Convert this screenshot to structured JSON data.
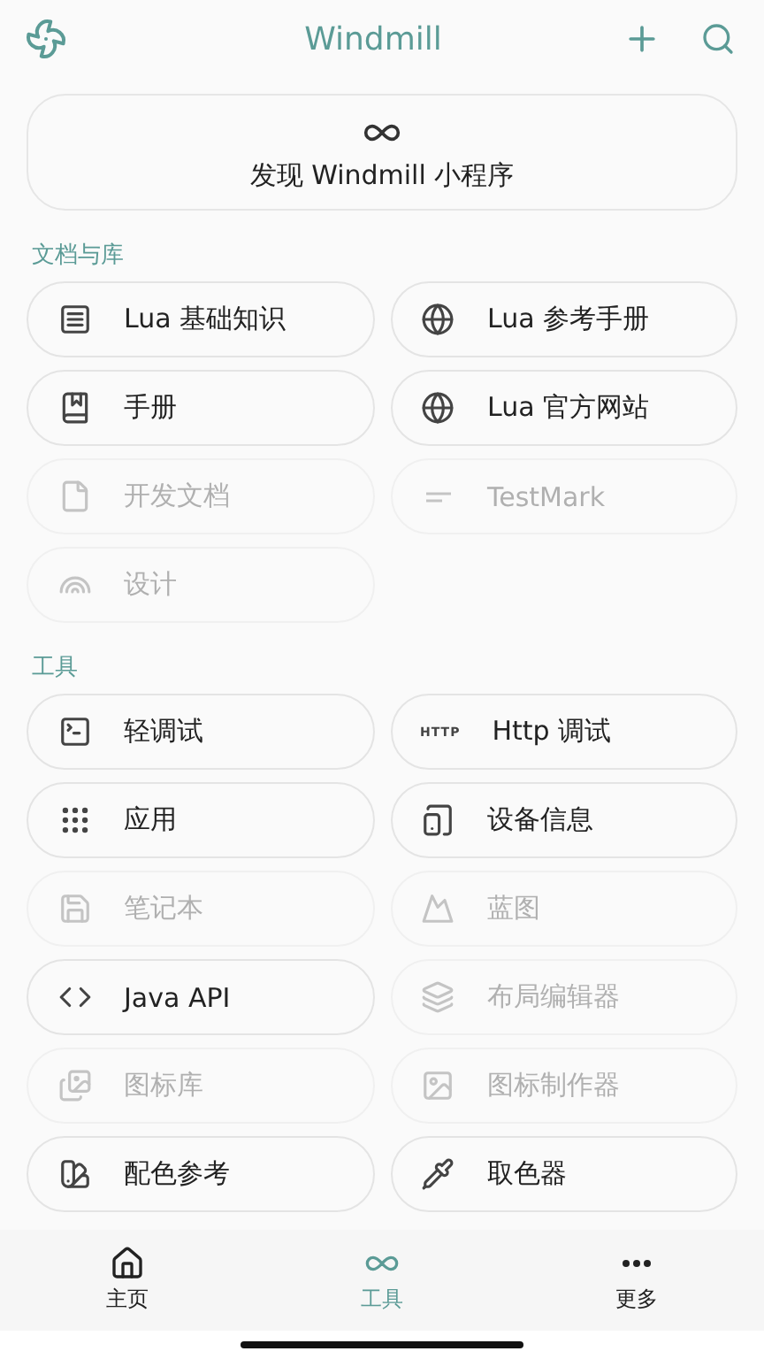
{
  "app_bar": {
    "title": "Windmill"
  },
  "discover": {
    "label": "发现 Windmill 小程序"
  },
  "sections": [
    {
      "title": "文档与库",
      "items": [
        {
          "kind": "list",
          "label": "Lua 基础知识",
          "disabled": false
        },
        {
          "kind": "globe",
          "label": "Lua 参考手册",
          "disabled": false
        },
        {
          "kind": "book",
          "label": "手册",
          "disabled": false
        },
        {
          "kind": "globe",
          "label": "Lua 官方网站",
          "disabled": false
        },
        {
          "kind": "file",
          "label": "开发文档",
          "disabled": true
        },
        {
          "kind": "lines",
          "label": "TestMark",
          "disabled": true
        },
        {
          "kind": "rainbow",
          "label": "设计",
          "disabled": true
        }
      ]
    },
    {
      "title": "工具",
      "items": [
        {
          "kind": "terminal",
          "label": "轻调试",
          "disabled": false
        },
        {
          "kind": "http",
          "badge": "HTTP",
          "label": "Http 调试",
          "disabled": false
        },
        {
          "kind": "grid",
          "label": "应用",
          "disabled": false
        },
        {
          "kind": "device",
          "label": "设备信息",
          "disabled": false
        },
        {
          "kind": "note",
          "label": "笔记本",
          "disabled": true
        },
        {
          "kind": "mountain",
          "label": "蓝图",
          "disabled": true
        },
        {
          "kind": "code",
          "label": "Java API",
          "disabled": false
        },
        {
          "kind": "layers",
          "label": "布局编辑器",
          "disabled": true
        },
        {
          "kind": "images",
          "label": "图标库",
          "disabled": true
        },
        {
          "kind": "image",
          "label": "图标制作器",
          "disabled": true
        },
        {
          "kind": "swatch",
          "label": "配色参考",
          "disabled": false
        },
        {
          "kind": "pipette",
          "label": "取色器",
          "disabled": false
        }
      ]
    }
  ],
  "bottom_nav": [
    {
      "kind": "home",
      "label": "主页",
      "selected": false
    },
    {
      "kind": "infinity",
      "label": "工具",
      "selected": true
    },
    {
      "kind": "more",
      "label": "更多",
      "selected": false
    }
  ]
}
